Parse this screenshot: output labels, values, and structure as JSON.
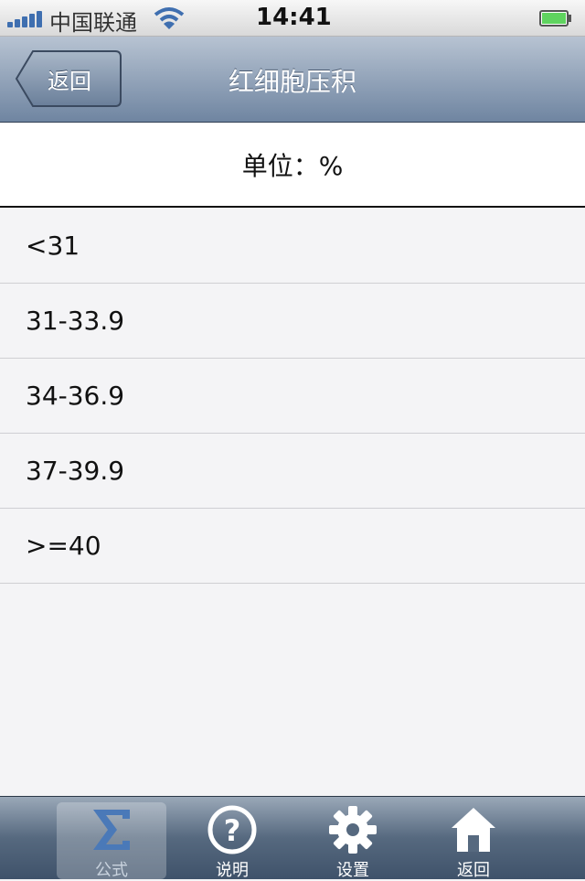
{
  "status_bar": {
    "carrier": "中国联通",
    "time": "14:41"
  },
  "nav": {
    "back_label": "返回",
    "title": "红细胞压积"
  },
  "unit_label": "单位：%",
  "ranges": [
    "<31",
    "31-33.9",
    "34-36.9",
    "37-39.9",
    ">=40"
  ],
  "tabs": [
    {
      "label": "公式",
      "icon": "sigma-icon",
      "active": true
    },
    {
      "label": "说明",
      "icon": "help-icon",
      "active": false
    },
    {
      "label": "设置",
      "icon": "gear-icon",
      "active": false
    },
    {
      "label": "返回",
      "icon": "home-icon",
      "active": false
    }
  ],
  "colors": {
    "signal": "#3f6fb0",
    "battery": "#5fd35f",
    "nav_gradient_top": "#b7c3d2",
    "nav_gradient_bottom": "#6f85a1"
  }
}
